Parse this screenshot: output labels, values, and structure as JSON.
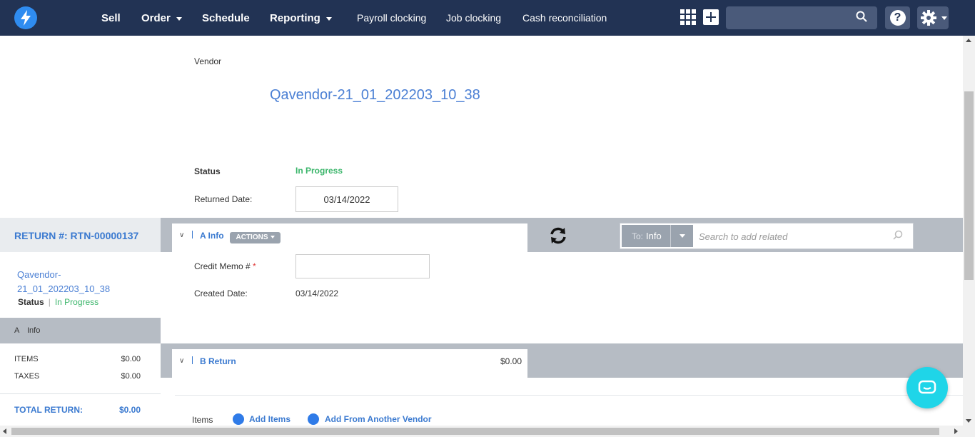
{
  "nav": {
    "sell": "Sell",
    "order": "Order",
    "schedule": "Schedule",
    "reporting": "Reporting",
    "payroll_clocking": "Payroll clocking",
    "job_clocking": "Job clocking",
    "cash_reconciliation": "Cash reconciliation",
    "help": "?"
  },
  "header": {
    "vendor_label": "Vendor",
    "vendor_name": "Qavendor-21_01_202203_10_38",
    "status_label": "Status",
    "status_value": "In Progress",
    "returned_date_label": "Returned Date:",
    "returned_date_value": "03/14/2022"
  },
  "sidebar": {
    "return_number": "RETURN #: RTN-00000137",
    "vendor_name": "Qavendor-21_01_202203_10_38",
    "status_label": "Status",
    "status_sep": "|",
    "status_value": "In Progress",
    "info_letter": "A",
    "info_label": "Info",
    "items_label": "ITEMS",
    "items_value": "$0.00",
    "taxes_label": "TAXES",
    "taxes_value": "$0.00",
    "total_label": "TOTAL RETURN:",
    "total_value": "$0.00"
  },
  "section_a": {
    "title": "A Info",
    "actions": "ACTIONS",
    "credit_memo_label": "Credit Memo #",
    "required_mark": "*",
    "credit_memo_value": "",
    "created_date_label": "Created Date:",
    "created_date_value": "03/14/2022"
  },
  "related": {
    "to_prefix": "To:",
    "to_value": "Info",
    "search_placeholder": "Search to add related"
  },
  "section_b": {
    "title": "B Return",
    "amount": "$0.00"
  },
  "items_row": {
    "label": "Items",
    "add_items": "Add Items",
    "add_from_vendor": "Add From Another Vendor"
  },
  "colors": {
    "topbar": "#223354",
    "link": "#3b7ad0",
    "status_green": "#3ab56a",
    "band_gray": "#b6bcc4",
    "chat_cyan": "#1fd5e8"
  }
}
